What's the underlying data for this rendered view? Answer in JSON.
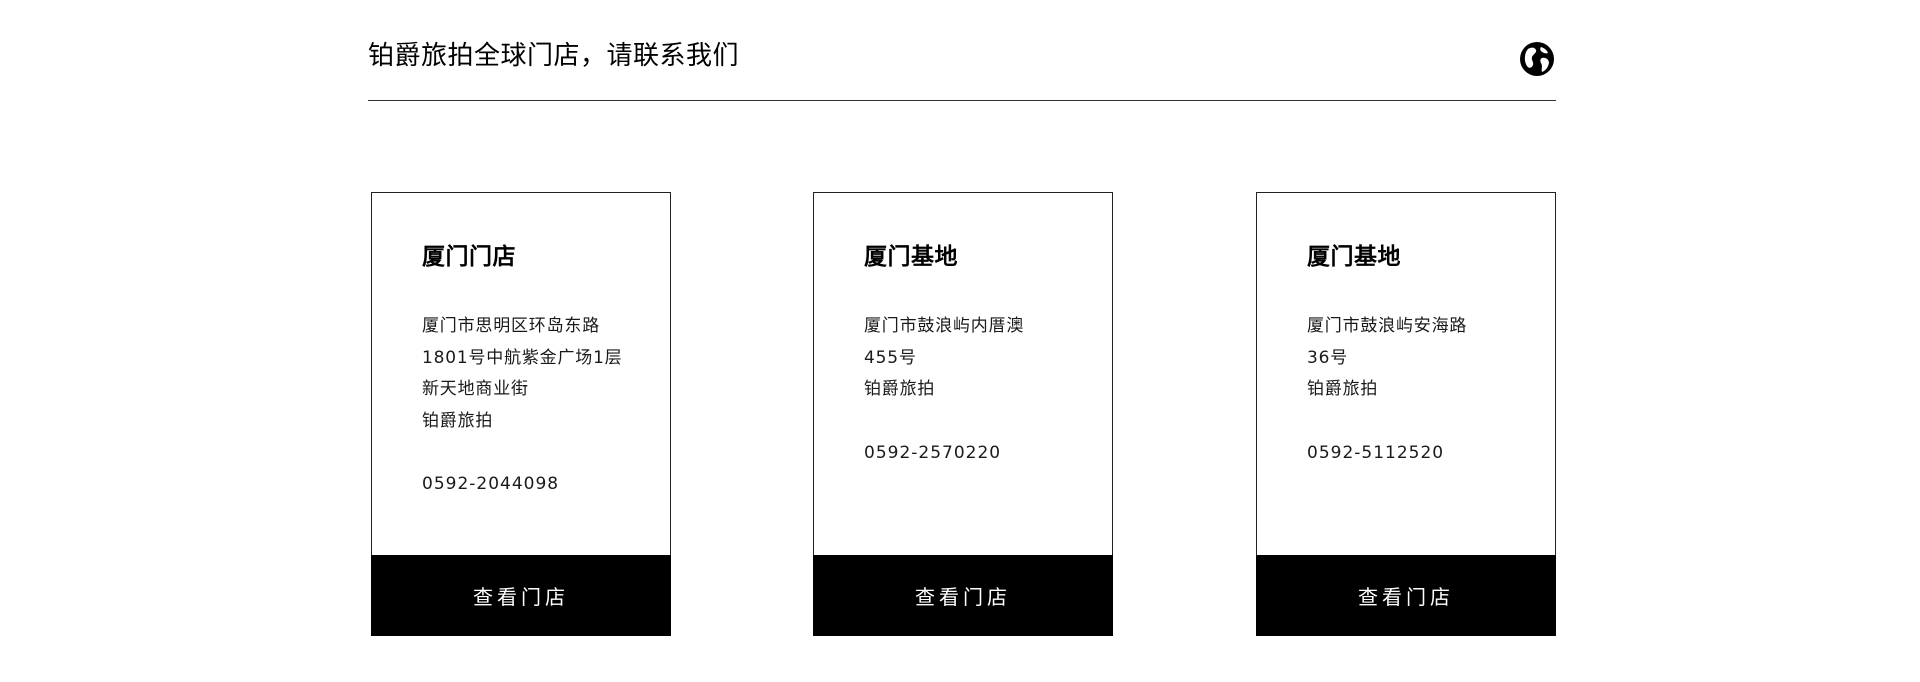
{
  "header": {
    "title": "铂爵旅拍全球门店，请联系我们",
    "globe_icon": "globe-icon"
  },
  "stores": [
    {
      "name": "厦门门店",
      "address_lines": [
        "厦门市思明区环岛东路",
        "1801号中航紫金广场1层",
        "新天地商业街",
        "铂爵旅拍"
      ],
      "phone": "0592-2044098",
      "button_label": "查看门店"
    },
    {
      "name": "厦门基地",
      "address_lines": [
        "厦门市鼓浪屿内厝澳",
        "455号",
        "铂爵旅拍"
      ],
      "phone": "0592-2570220",
      "button_label": "查看门店"
    },
    {
      "name": "厦门基地",
      "address_lines": [
        "厦门市鼓浪屿安海路",
        "36号",
        "铂爵旅拍"
      ],
      "phone": "0592-5112520",
      "button_label": "查看门店"
    }
  ],
  "colors": {
    "background": "#ffffff",
    "text": "#000000",
    "button_background": "#000000",
    "button_text": "#ffffff"
  }
}
